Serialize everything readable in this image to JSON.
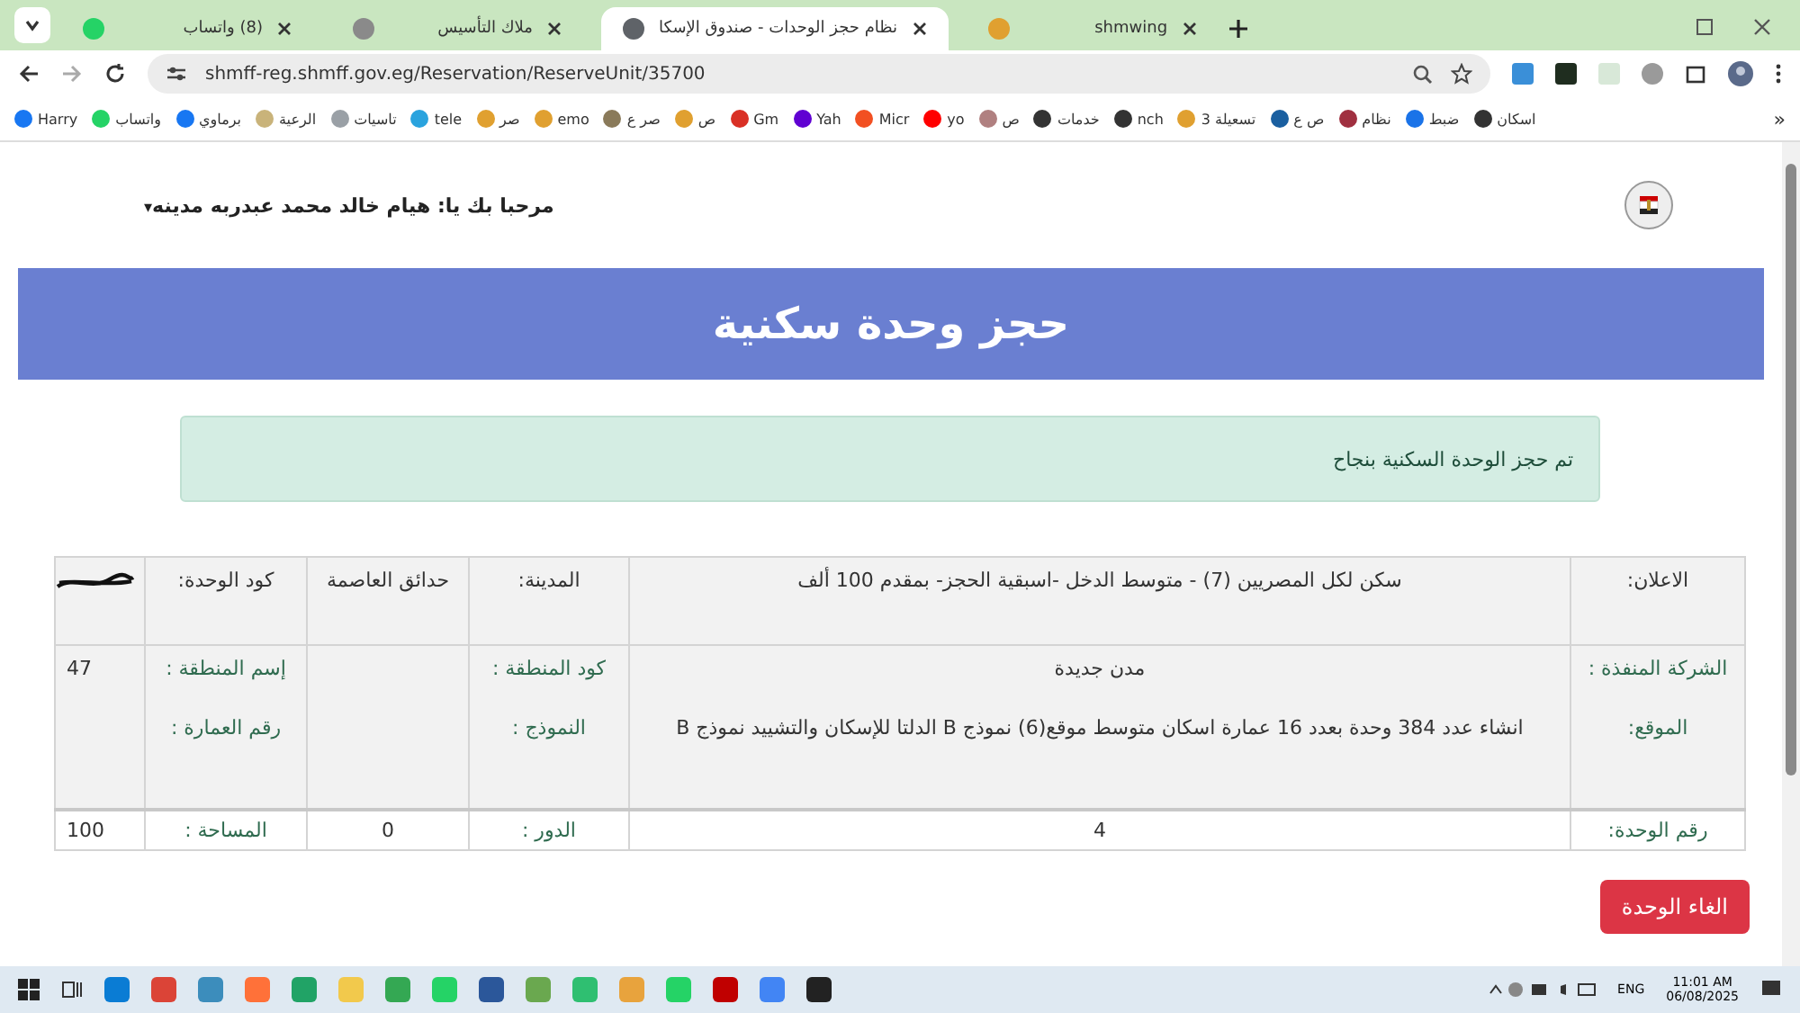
{
  "browser": {
    "tabs": [
      {
        "title": "shmwing",
        "selected": false,
        "color": "#e0a030"
      },
      {
        "title": "نظام حجز الوحدات - صندوق الإسكا",
        "selected": true,
        "color": "#5f6368"
      },
      {
        "title": "ملاك التأسيس",
        "selected": false,
        "color": "#8a8a8a"
      },
      {
        "title": "(8) واتساب",
        "selected": false,
        "color": "#25d366"
      }
    ],
    "url": "shmff-reg.shmff.gov.eg/Reservation/ReserveUnit/35700",
    "bookmarks": [
      {
        "label": "اسكان",
        "color": "#333333"
      },
      {
        "label": "ضبط",
        "color": "#1a73e8"
      },
      {
        "label": "نظام",
        "color": "#a03040"
      },
      {
        "label": "ص ع",
        "color": "#1a5fa0"
      },
      {
        "label": "تسعيلة 3",
        "color": "#e0a030"
      },
      {
        "label": "nch",
        "color": "#333333"
      },
      {
        "label": "خدمات",
        "color": "#333333"
      },
      {
        "label": "ص",
        "color": "#b08080"
      },
      {
        "label": "yo",
        "color": "#ff0000"
      },
      {
        "label": "Micr",
        "color": "#f25022"
      },
      {
        "label": "Yah",
        "color": "#6001d2"
      },
      {
        "label": "Gm",
        "color": "#d93025"
      },
      {
        "label": "ص",
        "color": "#e0a030"
      },
      {
        "label": "صر ع",
        "color": "#8a7a5a"
      },
      {
        "label": "emo",
        "color": "#e0a030"
      },
      {
        "label": "صر",
        "color": "#e0a030"
      },
      {
        "label": "tele",
        "color": "#2aa3de"
      },
      {
        "label": "تاسيات",
        "color": "#9aa0a6"
      },
      {
        "label": "الرعية",
        "color": "#c9b37a"
      },
      {
        "label": "برماوي",
        "color": "#1877f2"
      },
      {
        "label": "واتساب",
        "color": "#25d366"
      },
      {
        "label": "Harry",
        "color": "#1877f2"
      }
    ],
    "more": "»"
  },
  "header": {
    "welcome": "مرحبا بك يا: هيام خالد محمد عبدربه مدينه",
    "caret": "▾"
  },
  "banner": {
    "title": "حجز وحدة سكنية"
  },
  "alert": {
    "message": "تم حجز الوحدة السكنية بنجاح"
  },
  "table": {
    "rows": [
      {
        "shaded": true,
        "cells": [
          {
            "kind": "label",
            "texts": [
              "الاعلان:"
            ]
          },
          {
            "kind": "value",
            "texts": [
              "سكن لكل المصريين (7) - متوسط الدخل -اسبقية الحجز- بمقدم 100 ألف"
            ]
          },
          {
            "kind": "label",
            "texts": [
              "المدينة:"
            ]
          },
          {
            "kind": "value",
            "texts": [
              "حدائق العاصمة"
            ]
          },
          {
            "kind": "label",
            "texts": [
              "كود الوحدة:"
            ]
          },
          {
            "kind": "redacted"
          }
        ]
      },
      {
        "shaded": true,
        "cells": [
          {
            "kind": "label",
            "texts": [
              "الشركة المنفذة :",
              "الموقع:"
            ]
          },
          {
            "kind": "value",
            "texts": [
              "مدن جديدة",
              "انشاء عدد 384 وحدة بعدد 16 عمارة اسكان متوسط موقع(6) نموذج B الدلتا للإسكان والتشييد نموذج B"
            ]
          },
          {
            "kind": "label",
            "texts": [
              "كود المنطقة :",
              "النموذج :"
            ]
          },
          {
            "kind": "value"
          },
          {
            "kind": "label",
            "texts": [
              "إسم المنطقة :",
              "رقم العمارة :"
            ]
          },
          {
            "kind": "value",
            "texts": [
              "47"
            ]
          }
        ]
      },
      {
        "shaded": false,
        "cells": [
          {
            "kind": "label",
            "texts": [
              "رقم الوحدة:"
            ]
          },
          {
            "kind": "value",
            "texts": [
              "4"
            ]
          },
          {
            "kind": "label",
            "texts": [
              "الدور :"
            ]
          },
          {
            "kind": "value",
            "texts": [
              "0"
            ]
          },
          {
            "kind": "label",
            "texts": [
              "المساحة :"
            ]
          },
          {
            "kind": "value",
            "texts": [
              "100"
            ]
          }
        ]
      }
    ]
  },
  "cancel_button": "الغاء الوحدة",
  "taskbar": {
    "language": "ENG",
    "time": "11:01 AM",
    "date": "06/08/2025"
  }
}
